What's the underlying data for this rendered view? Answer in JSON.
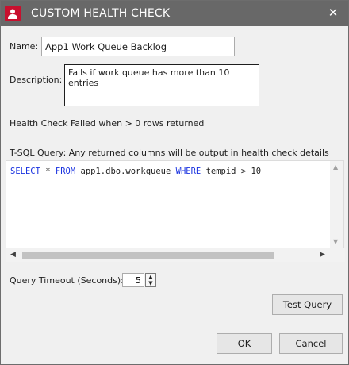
{
  "window": {
    "title": "CUSTOM HEALTH CHECK",
    "close_glyph": "✕",
    "icon": "user-shield-icon",
    "accent_color": "#c8102e",
    "titlebar_color": "#686868"
  },
  "form": {
    "name_label": "Name:",
    "name_value": "App1 Work Queue Backlog",
    "description_label": "Description:",
    "description_value": "Fails if work queue has more than 10 entries",
    "failure_rule": "Health Check Failed when > 0 rows returned",
    "sql_label": "T-SQL Query: Any returned columns will be output in health check details",
    "sql": {
      "kw_select": "SELECT",
      "part1": " * ",
      "kw_from": "FROM",
      "part2": " app1.dbo.workqueue ",
      "kw_where": "WHERE",
      "part3": " tempid > 10"
    },
    "timeout_label": "Query Timeout (Seconds):",
    "timeout_value": "5"
  },
  "buttons": {
    "test_query": "Test Query",
    "ok": "OK",
    "cancel": "Cancel"
  }
}
